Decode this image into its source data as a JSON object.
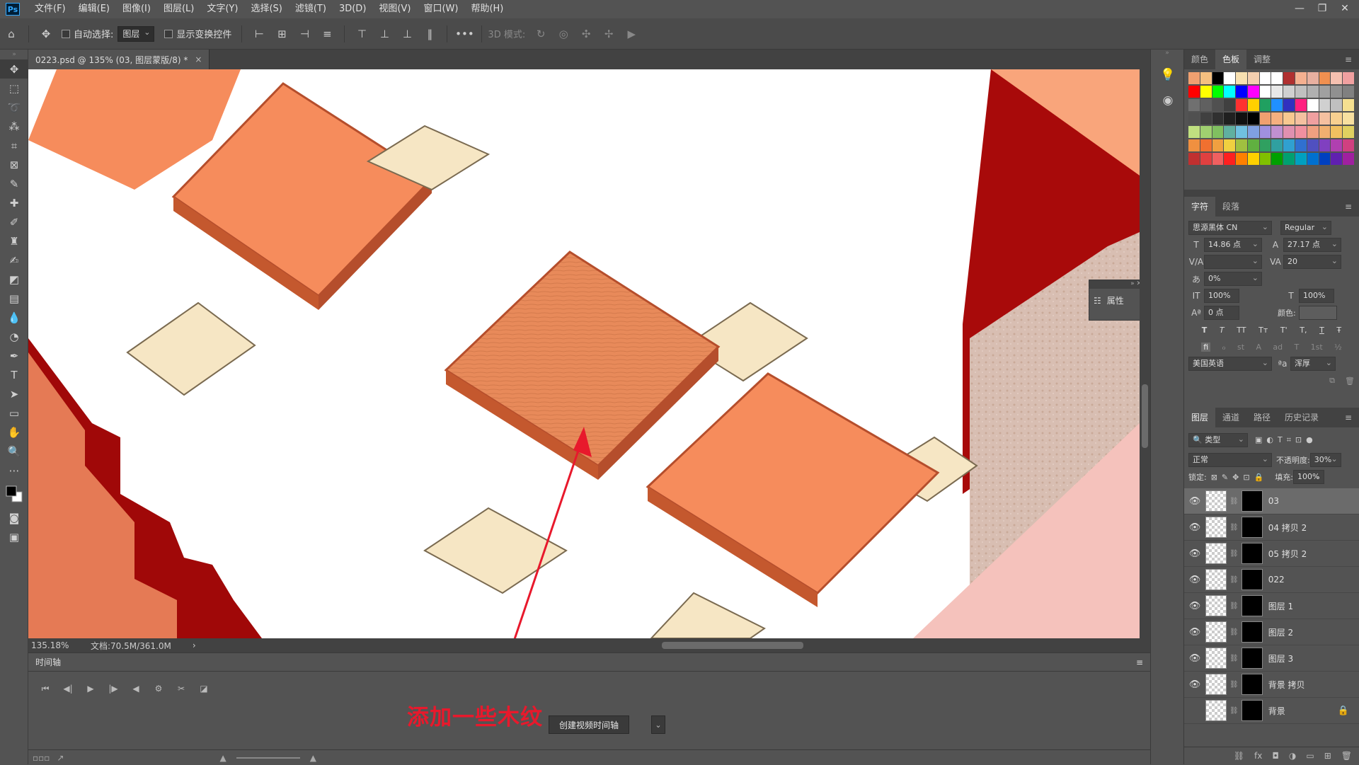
{
  "app": {
    "logo": "Ps"
  },
  "menu": [
    "文件(F)",
    "编辑(E)",
    "图像(I)",
    "图层(L)",
    "文字(Y)",
    "选择(S)",
    "滤镜(T)",
    "3D(D)",
    "视图(V)",
    "窗口(W)",
    "帮助(H)"
  ],
  "window_buttons": [
    "—",
    "❐",
    "✕"
  ],
  "options": {
    "auto_select_label": "自动选择:",
    "auto_select_value": "图层",
    "show_transform_label": "显示变换控件",
    "more": "•••",
    "mode_3d_label": "3D 模式:"
  },
  "document": {
    "tab_title": "0223.psd @ 135% (03, 图层蒙版/8) *",
    "close": "×"
  },
  "status": {
    "zoom": "135.18%",
    "doc_size": "文档:70.5M/361.0M",
    "arrow": "›"
  },
  "timeline": {
    "title": "时间轴",
    "create_button": "创建视频时间轴",
    "dropdown": "⌄"
  },
  "annotation": {
    "text": "添加一些木纹"
  },
  "properties_float": {
    "label": "属性"
  },
  "swatches_panel": {
    "tabs": [
      "颜色",
      "色板",
      "调整"
    ],
    "active_tab": "色板",
    "rows": [
      [
        "#f0a070",
        "#f5c080",
        "#000000",
        "#ffffff",
        "#f8e0b0",
        "#f5d0b0",
        "#ffffff",
        "#ffffff",
        "#b03030",
        "#f5b090",
        "#e8b0a0",
        "#f09050",
        "#f5c0b0",
        "#f0a0a0"
      ],
      [
        "#ff0000",
        "#ffff00",
        "#00ff00",
        "#00ffff",
        "#0000ff",
        "#ff00ff",
        "#ffffff",
        "#e8e8e8",
        "#d0d0d0",
        "#c0c0c0",
        "#b0b0b0",
        "#a0a0a0",
        "#909090",
        "#808080"
      ],
      [
        "#707070",
        "#606060",
        "#505050",
        "#404040",
        "#ff3030",
        "#ffd000",
        "#20a060",
        "#2090ff",
        "#3030c0",
        "#ff2080",
        "#ffffff",
        "#d0d0d0",
        "#c0c0c0",
        "#f5e090"
      ],
      [
        "#505050",
        "#404040",
        "#303030",
        "#202020",
        "#101010",
        "#000000",
        "#f0a070",
        "#f5b080",
        "#f8c890",
        "#f5c0a0",
        "#f0a0a0",
        "#f5c0a0",
        "#f8d090",
        "#f8e0a0"
      ],
      [
        "#c0e080",
        "#a0d070",
        "#80c060",
        "#60b0a0",
        "#70c0e0",
        "#80a0e0",
        "#a090e0",
        "#c090d0",
        "#e090b0",
        "#f090a0",
        "#f0a080",
        "#f0b070",
        "#f0c060",
        "#e0d060"
      ],
      [
        "#f09040",
        "#f07030",
        "#f0a040",
        "#f0d040",
        "#a0c040",
        "#60b040",
        "#30a060",
        "#30a0a0",
        "#30a0d0",
        "#3070d0",
        "#5050c0",
        "#8040c0",
        "#b040b0",
        "#d04080"
      ],
      [
        "#c03030",
        "#e04040",
        "#f06060",
        "#ff2020",
        "#ff8000",
        "#ffd000",
        "#80c000",
        "#00a000",
        "#00a070",
        "#00a0c0",
        "#0070d0",
        "#0040c0",
        "#6020b0",
        "#a020a0"
      ]
    ]
  },
  "character_panel": {
    "tabs": [
      "字符",
      "段落"
    ],
    "font_family": "思源黑体 CN",
    "font_style": "Regular",
    "font_size": "14.86 点",
    "leading": "27.17 点",
    "kerning": "",
    "tracking": "20",
    "scale_pct": "0%",
    "vscale": "100%",
    "hscale": "100%",
    "baseline": "0 点",
    "color_label": "颜色:",
    "style_buttons": [
      "T",
      "T",
      "TT",
      "Tт",
      "T'",
      "T,",
      "T",
      "Ŧ"
    ],
    "ot_buttons": [
      "fi",
      "ℴ",
      "st",
      "A",
      "ad",
      "T",
      "1st",
      "½"
    ],
    "language": "美国英语",
    "aa_label": "ªa",
    "antialias": "浑厚"
  },
  "layers_panel": {
    "tabs": [
      "图层",
      "通道",
      "路径",
      "历史记录"
    ],
    "filter": "类型",
    "blend_mode": "正常",
    "opacity_label": "不透明度:",
    "opacity": "30%",
    "lock_label": "锁定:",
    "fill_label": "填充:",
    "fill": "100%",
    "layers": [
      {
        "name": "03",
        "selected": true,
        "visible": true
      },
      {
        "name": "04 拷贝 2",
        "selected": false,
        "visible": true
      },
      {
        "name": "05 拷贝 2",
        "selected": false,
        "visible": true
      },
      {
        "name": "022",
        "selected": false,
        "visible": true
      },
      {
        "name": "图层 1",
        "selected": false,
        "visible": true
      },
      {
        "name": "图层 2",
        "selected": false,
        "visible": true
      },
      {
        "name": "图层 3",
        "selected": false,
        "visible": true
      },
      {
        "name": "背景 拷贝",
        "selected": false,
        "visible": true
      },
      {
        "name": "背景",
        "selected": false,
        "visible": false,
        "locked": true
      }
    ]
  }
}
